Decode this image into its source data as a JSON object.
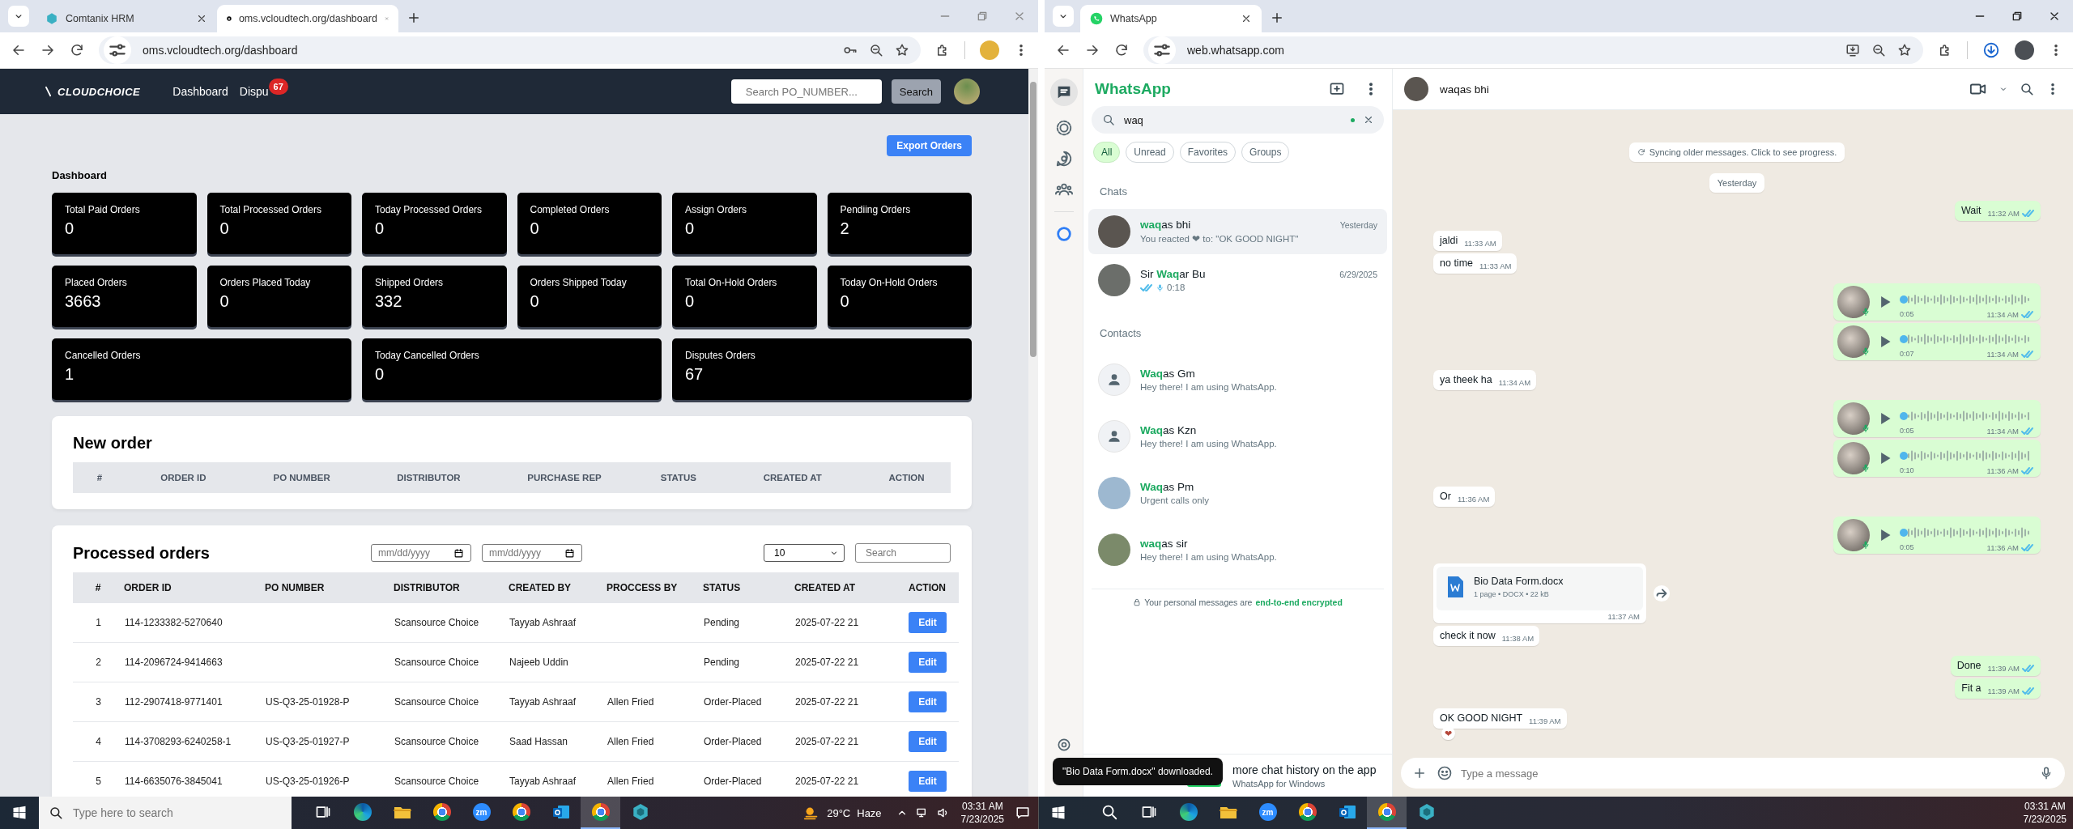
{
  "left_browser": {
    "tabs": [
      {
        "title": "Comtanix HRM",
        "selected": false
      },
      {
        "title": "oms.vcloudtech.org/dashboard",
        "selected": true
      }
    ],
    "address": "oms.vcloudtech.org/dashboard"
  },
  "oms": {
    "logo": "CLOUDCHOICE",
    "nav": [
      {
        "label": "Dashboard"
      },
      {
        "label": "Dispu",
        "badge": "67"
      }
    ],
    "search_placeholder": "Search PO_NUMBER...",
    "search_button": "Search",
    "export_button": "Export Orders",
    "heading": "Dashboard",
    "stats": [
      {
        "label": "Total Paid Orders",
        "value": "0"
      },
      {
        "label": "Total Processed Orders",
        "value": "0"
      },
      {
        "label": "Today Processed Orders",
        "value": "0"
      },
      {
        "label": "Completed Orders",
        "value": "0"
      },
      {
        "label": "Assign Orders",
        "value": "0"
      },
      {
        "label": "Pendiing Orders",
        "value": "2"
      },
      {
        "label": "Placed Orders",
        "value": "3663"
      },
      {
        "label": "Orders Placed Today",
        "value": "0"
      },
      {
        "label": "Shipped Orders",
        "value": "332"
      },
      {
        "label": "Orders Shipped Today",
        "value": "0"
      },
      {
        "label": "Total On-Hold Orders",
        "value": "0"
      },
      {
        "label": "Today On-Hold Orders",
        "value": "0"
      },
      {
        "label": "Cancelled Orders",
        "value": "1"
      },
      {
        "label": "Today Cancelled Orders",
        "value": "0"
      },
      {
        "label": "Disputes Orders",
        "value": "67"
      }
    ],
    "new_order": {
      "title": "New order",
      "columns": [
        "#",
        "ORDER ID",
        "PO NUMBER",
        "DISTRIBUTOR",
        "PURCHASE REP",
        "STATUS",
        "CREATED AT",
        "ACTION"
      ]
    },
    "processed": {
      "title": "Processed orders",
      "date_placeholders": [
        "mm/dd/yyyy",
        "mm/dd/yyyy"
      ],
      "page_size": "10",
      "search_placeholder": "Search",
      "columns": [
        "#",
        "ORDER ID",
        "PO NUMBER",
        "DISTRIBUTOR",
        "CREATED BY",
        "PROCCESS BY",
        "STATUS",
        "CREATED AT",
        "ACTION"
      ],
      "rows": [
        {
          "cells": [
            "1",
            "114-1233382-5270640",
            "",
            "Scansource Choice",
            "Tayyab Ashraaf",
            "",
            "Pending",
            "2025-07-22 21"
          ],
          "action": "Edit"
        },
        {
          "cells": [
            "2",
            "114-2096724-9414663",
            "",
            "Scansource Choice",
            "Najeeb Uddin",
            "",
            "Pending",
            "2025-07-22 21"
          ],
          "action": "Edit"
        },
        {
          "cells": [
            "3",
            "112-2907418-9771401",
            "US-Q3-25-01928-P",
            "Scansource Choice",
            "Tayyab Ashraaf",
            "Allen Fried",
            "Order-Placed",
            "2025-07-22 21"
          ],
          "action": "Edit"
        },
        {
          "cells": [
            "4",
            "114-3708293-6240258-1",
            "US-Q3-25-01927-P",
            "Scansource Choice",
            "Saad Hassan",
            "Allen Fried",
            "Order-Placed",
            "2025-07-22 21"
          ],
          "action": "Edit"
        },
        {
          "cells": [
            "5",
            "114-6635076-3845041",
            "US-Q3-25-01926-P",
            "Scansource Choice",
            "Tayyab Ashraaf",
            "Allen Fried",
            "Order-Placed",
            "2025-07-22 21"
          ],
          "action": "Edit"
        }
      ]
    }
  },
  "right_browser": {
    "tabs": [
      {
        "title": "WhatsApp",
        "selected": true
      }
    ],
    "address": "web.whatsapp.com"
  },
  "whatsapp": {
    "title": "WhatsApp",
    "search_value": "waq",
    "filters": [
      {
        "label": "All",
        "selected": true
      },
      {
        "label": "Unread",
        "selected": false
      },
      {
        "label": "Favorites",
        "selected": false
      },
      {
        "label": "Groups",
        "selected": false
      }
    ],
    "chats_heading": "Chats",
    "chats": [
      {
        "name": "**waq**as bhi",
        "time": "Yesterday",
        "kind": "text",
        "preview": "You reacted ❤ to: \"OK GOOD NIGHT\"",
        "selected": true
      },
      {
        "name": "Sir **Waq**ar Bu",
        "time": "6/29/2025",
        "kind": "voice",
        "preview": "0:18",
        "selected": false
      }
    ],
    "contacts_heading": "Contacts",
    "contacts": [
      {
        "name": "**Waq**as Gm",
        "status": "Hey there! I am using WhatsApp.",
        "kind": "default"
      },
      {
        "name": "**Waq**as Kzn",
        "status": "Hey there! I am using WhatsApp.",
        "kind": "default"
      },
      {
        "name": "**Waq**as Pm",
        "status": "Urgent calls only",
        "kind": "photo"
      },
      {
        "name": "**waq**as sir",
        "status": "Hey there! I am using WhatsApp.",
        "kind": "photo"
      }
    ],
    "encryption_text": "Your personal messages are",
    "encryption_link": "end-to-end encrypted",
    "banner_title": "more chat history on the app",
    "banner_subtitle": "WhatsApp for Windows",
    "toast": "\"Bio Data Form.docx\" downloaded.",
    "chat": {
      "contact": "waqas bhi",
      "sync_notice": "Syncing older messages. Click to see progress.",
      "date_chip": "Yesterday",
      "composer_placeholder": "Type a message",
      "messages": [
        {
          "kind": "text",
          "outgoing": true,
          "text": "Wait",
          "time": "11:32 AM"
        },
        {
          "kind": "text",
          "outgoing": false,
          "text": "jaldi",
          "time": "11:33 AM"
        },
        {
          "kind": "text",
          "outgoing": false,
          "text": "no time",
          "time": "11:33 AM"
        },
        {
          "kind": "voice",
          "outgoing": true,
          "duration": "0:05",
          "time": "11:34 AM"
        },
        {
          "kind": "voice",
          "outgoing": true,
          "duration": "0:07",
          "time": "11:34 AM"
        },
        {
          "kind": "text",
          "outgoing": false,
          "text": "ya theek ha",
          "time": "11:34 AM"
        },
        {
          "kind": "voice",
          "outgoing": true,
          "duration": "0:05",
          "time": "11:34 AM"
        },
        {
          "kind": "voice",
          "outgoing": true,
          "duration": "0:10",
          "time": "11:36 AM"
        },
        {
          "kind": "text",
          "outgoing": false,
          "text": "Or",
          "time": "11:36 AM"
        },
        {
          "kind": "voice",
          "outgoing": true,
          "duration": "0:05",
          "time": "11:36 AM"
        },
        {
          "kind": "document",
          "outgoing": false,
          "file_name": "Bio Data Form.docx",
          "details": "1 page • DOCX • 22 kB",
          "time": "11:37 AM"
        },
        {
          "kind": "text",
          "outgoing": false,
          "text": "check it now",
          "time": "11:38 AM"
        },
        {
          "kind": "text",
          "outgoing": true,
          "text": "Done",
          "time": "11:39 AM"
        },
        {
          "kind": "text",
          "outgoing": true,
          "text": "Fit a",
          "time": "11:39 AM"
        },
        {
          "kind": "text",
          "outgoing": false,
          "text": "OK GOOD NIGHT",
          "time": "11:39 AM",
          "reaction": "❤"
        }
      ]
    }
  },
  "taskbars": [
    {
      "search_placeholder": "Type here to search",
      "apps": [
        {
          "kind": "taskview",
          "selected": false
        },
        {
          "kind": "edge",
          "selected": false
        },
        {
          "kind": "folder",
          "selected": false
        },
        {
          "kind": "chrome",
          "selected": false
        },
        {
          "kind": "zoom",
          "label": "zm",
          "selected": false
        },
        {
          "kind": "chrome",
          "selected": false
        },
        {
          "kind": "outlook",
          "selected": false
        },
        {
          "kind": "chrome",
          "selected": true
        },
        {
          "kind": "hexagon",
          "selected": false
        }
      ],
      "temperature": "29°C",
      "condition": "Haze",
      "time": "03:31 AM",
      "date": "7/23/2025"
    },
    {
      "apps": [
        {
          "kind": "search",
          "selected": false
        },
        {
          "kind": "taskview",
          "selected": false
        },
        {
          "kind": "edge",
          "selected": false
        },
        {
          "kind": "folder",
          "selected": false
        },
        {
          "kind": "zoom",
          "label": "zm",
          "selected": false
        },
        {
          "kind": "chrome",
          "selected": false
        },
        {
          "kind": "outlook",
          "selected": false
        },
        {
          "kind": "chrome",
          "selected": true
        },
        {
          "kind": "hexagon",
          "selected": false
        }
      ],
      "time": "03:31 AM",
      "date": "7/23/2025"
    }
  ]
}
